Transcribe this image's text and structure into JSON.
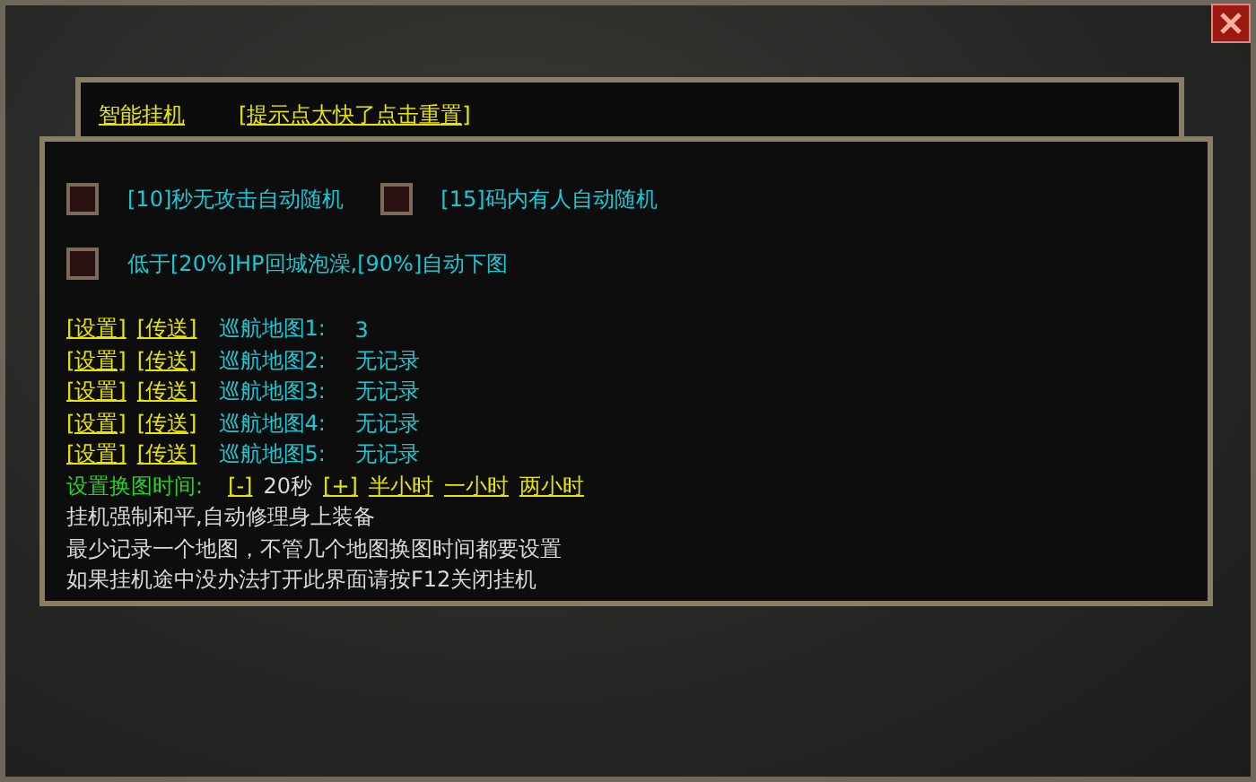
{
  "header": {
    "links": [
      "智能挂机",
      "[提示点太快了点击重置]"
    ]
  },
  "option_rows": [
    [
      {
        "label": "[10]秒无攻击自动随机",
        "checked": false
      },
      {
        "label": "[15]码内有人自动随机",
        "checked": false
      }
    ],
    [
      {
        "label": "低于[20%]HP回城泡澡,[90%]自动下图",
        "checked": false
      }
    ]
  ],
  "maps": [
    {
      "set": "[设置]",
      "teleport": "[传送]",
      "label": "巡航地图1:",
      "value": "3"
    },
    {
      "set": "[设置]",
      "teleport": "[传送]",
      "label": "巡航地图2:",
      "value": "无记录"
    },
    {
      "set": "[设置]",
      "teleport": "[传送]",
      "label": "巡航地图3:",
      "value": "无记录"
    },
    {
      "set": "[设置]",
      "teleport": "[传送]",
      "label": "巡航地图4:",
      "value": "无记录"
    },
    {
      "set": "[设置]",
      "teleport": "[传送]",
      "label": "巡航地图5:",
      "value": "无记录"
    }
  ],
  "switch_time": {
    "label": "设置换图时间:",
    "minus": "[-]",
    "value": "20秒",
    "plus": "[+]",
    "presets": [
      "半小时",
      "一小时",
      "两小时"
    ]
  },
  "notes": [
    "挂机强制和平,自动修理身上装备",
    "最少记录一个地图，不管几个地图换图时间都要设置",
    "如果挂机途中没办法打开此界面请按F12关闭挂机"
  ]
}
